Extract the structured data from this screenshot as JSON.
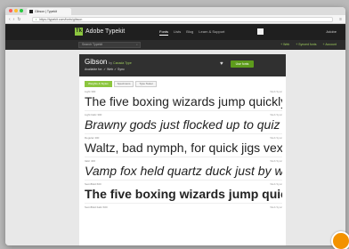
{
  "browser": {
    "tab_title": "Gibson | Typekit",
    "url": "https://typekit.com/fonts/gibson",
    "nav_back": "‹",
    "nav_forward": "›",
    "nav_reload": "↻",
    "menu_icon": "≡",
    "lock": "🔒"
  },
  "typekit_header": {
    "logo": "Tk",
    "brand": "Adobe Typekit",
    "nav": [
      "Fonts",
      "Lists",
      "Blog",
      "Learn & Support"
    ],
    "adobe_link": "Adobe"
  },
  "search": {
    "placeholder": "Search Typekit",
    "icon": "⌕",
    "filters": [
      "+ Web",
      "+ Synced fonts",
      "+ Account"
    ]
  },
  "font_header": {
    "name": "Gibson",
    "by": "by",
    "foundry": "Canada Type",
    "available": "Available for: ✓ Web  ✓ Sync",
    "heart": "♥",
    "use_button": "Use fonts"
  },
  "view_tabs": [
    "Weights & Styles",
    "Specimens",
    "Type Tester"
  ],
  "samples": [
    {
      "label": "Light 300",
      "right": "Web  Sync",
      "text": "The five boxing wizards jump quickly."
    },
    {
      "label": "Light Italic 300",
      "right": "Web  Sync",
      "text": "Brawny gods just flocked up to quiz and vex him."
    },
    {
      "label": "Regular 400",
      "right": "Web  Sync",
      "text": "Waltz, bad nymph, for quick jigs vex."
    },
    {
      "label": "Italic 400",
      "right": "Web  Sync",
      "text": "Vamp fox held quartz duck just by wing."
    },
    {
      "label": "SemiBold 600",
      "right": "Web  Sync",
      "text": "The five boxing wizards jump quickly."
    },
    {
      "label": "SemiBold Italic 600",
      "right": "Web  Sync",
      "text": ""
    }
  ]
}
